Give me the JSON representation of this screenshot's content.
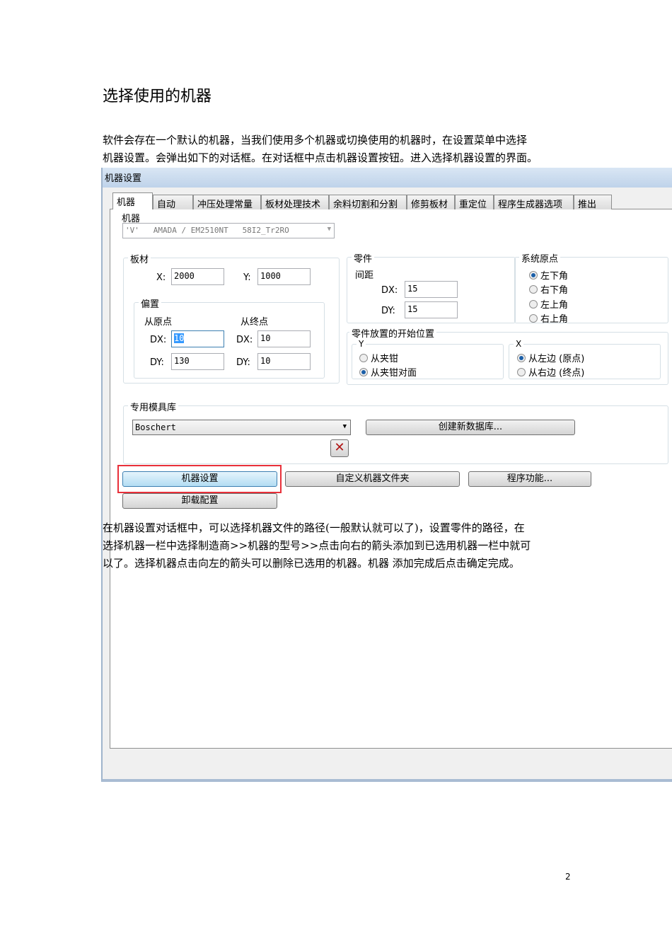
{
  "heading": "选择使用的机器",
  "intro": [
    "软件会存在一个默认的机器，当我们使用多个机器或切换使用的机器时，在设置菜单中选择",
    "机器设置。会弹出如下的对话框。在对话框中点击机器设置按钮。进入选择机器设置的界面。"
  ],
  "dialog": {
    "title": "机器设置",
    "tabs": [
      "机器",
      "自动",
      "冲压处理常量",
      "板材处理技术",
      "余料切割和分割",
      "修剪板材",
      "重定位",
      "程序生成器选项",
      "推出"
    ],
    "machine_label": "机器",
    "machine_value": "'V'   AMADA / EM2510NT   58I2_Tr2RO",
    "sheet": {
      "title": "板材",
      "x_label": "X:",
      "x": "2000",
      "y_label": "Y:",
      "y": "1000",
      "offset": {
        "title": "偏置",
        "from_origin": "从原点",
        "from_end": "从终点",
        "dx_label": "DX:",
        "dy_label": "DY:",
        "origin_dx": "10",
        "origin_dy": "130",
        "end_dx": "10",
        "end_dy": "10"
      }
    },
    "part": {
      "title": "零件",
      "spacing": "间距",
      "dx_label": "DX:",
      "dx": "15",
      "dy_label": "DY:",
      "dy": "15"
    },
    "origin": {
      "title": "系统原点",
      "options": [
        "左下角",
        "右下角",
        "左上角",
        "右上角"
      ],
      "selected": 0
    },
    "start": {
      "title": "零件放置的开始位置",
      "y_title": "Y",
      "y_options": [
        "从夹钳",
        "从夹钳对面"
      ],
      "y_selected": 1,
      "x_title": "X",
      "x_options": [
        "从左边 (原点)",
        "从右边 (终点)"
      ],
      "x_selected": 0
    },
    "tooling": {
      "title": "专用模具库",
      "value": "Boschert",
      "create_button": "创建新数据库..."
    },
    "buttons": {
      "machine_settings": "机器设置",
      "custom_folder": "自定义机器文件夹",
      "program_functions": "程序功能...",
      "unload_config": "卸载配置"
    }
  },
  "body": [
    "在机器设置对话框中，可以选择机器文件的路径(一般默认就可以了)，设置零件的路径，在",
    "选择机器一栏中选择制造商>>机器的型号>>点击向右的箭头添加到已选用机器一栏中就可",
    "以了。选择机器点击向左的箭头可以删除已选用的机器。机器  添加完成后点击确定完成。"
  ],
  "page_number": "2",
  "colors": {
    "highlight": "#e8303a"
  }
}
